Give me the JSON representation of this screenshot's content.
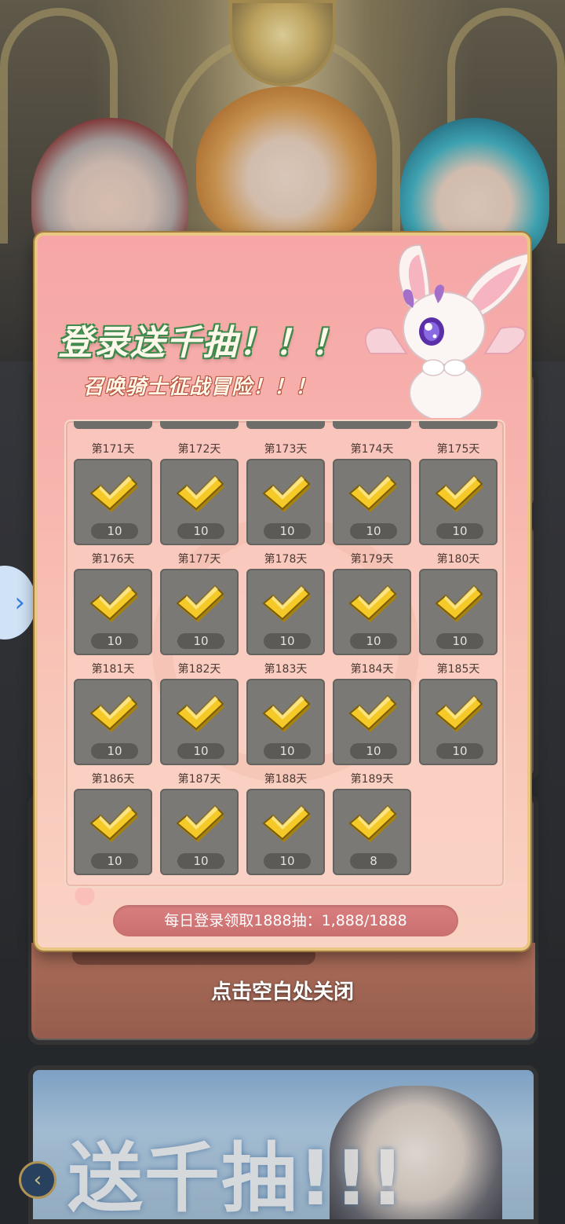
{
  "popup": {
    "title": "登录送千抽！！！",
    "subtitle": "召唤骑士征战冒险！！！",
    "progress_text": "每日登录领取1888抽：1,888/1888",
    "close_hint": "点击空白处关闭"
  },
  "days": [
    {
      "label": "第171天",
      "count": "10"
    },
    {
      "label": "第172天",
      "count": "10"
    },
    {
      "label": "第173天",
      "count": "10"
    },
    {
      "label": "第174天",
      "count": "10"
    },
    {
      "label": "第175天",
      "count": "10"
    },
    {
      "label": "第176天",
      "count": "10"
    },
    {
      "label": "第177天",
      "count": "10"
    },
    {
      "label": "第178天",
      "count": "10"
    },
    {
      "label": "第179天",
      "count": "10"
    },
    {
      "label": "第180天",
      "count": "10"
    },
    {
      "label": "第181天",
      "count": "10"
    },
    {
      "label": "第182天",
      "count": "10"
    },
    {
      "label": "第183天",
      "count": "10"
    },
    {
      "label": "第184天",
      "count": "10"
    },
    {
      "label": "第185天",
      "count": "10"
    },
    {
      "label": "第186天",
      "count": "10"
    },
    {
      "label": "第187天",
      "count": "10"
    },
    {
      "label": "第188天",
      "count": "10"
    },
    {
      "label": "第189天",
      "count": "8"
    }
  ],
  "background": {
    "banner_text": "送千抽!!!"
  },
  "icons": {
    "reward": "gold-check-icon",
    "back": "back-arrow-icon",
    "side_tab": "chevron-right-icon"
  },
  "colors": {
    "popup_bg": "#f7b2ad",
    "popup_border": "#e9c783",
    "tile_bg": "#7a7975",
    "check_gold": "#f5c928",
    "progress_pill": "#d97f7f",
    "title_outline": "#3f8a4c"
  }
}
